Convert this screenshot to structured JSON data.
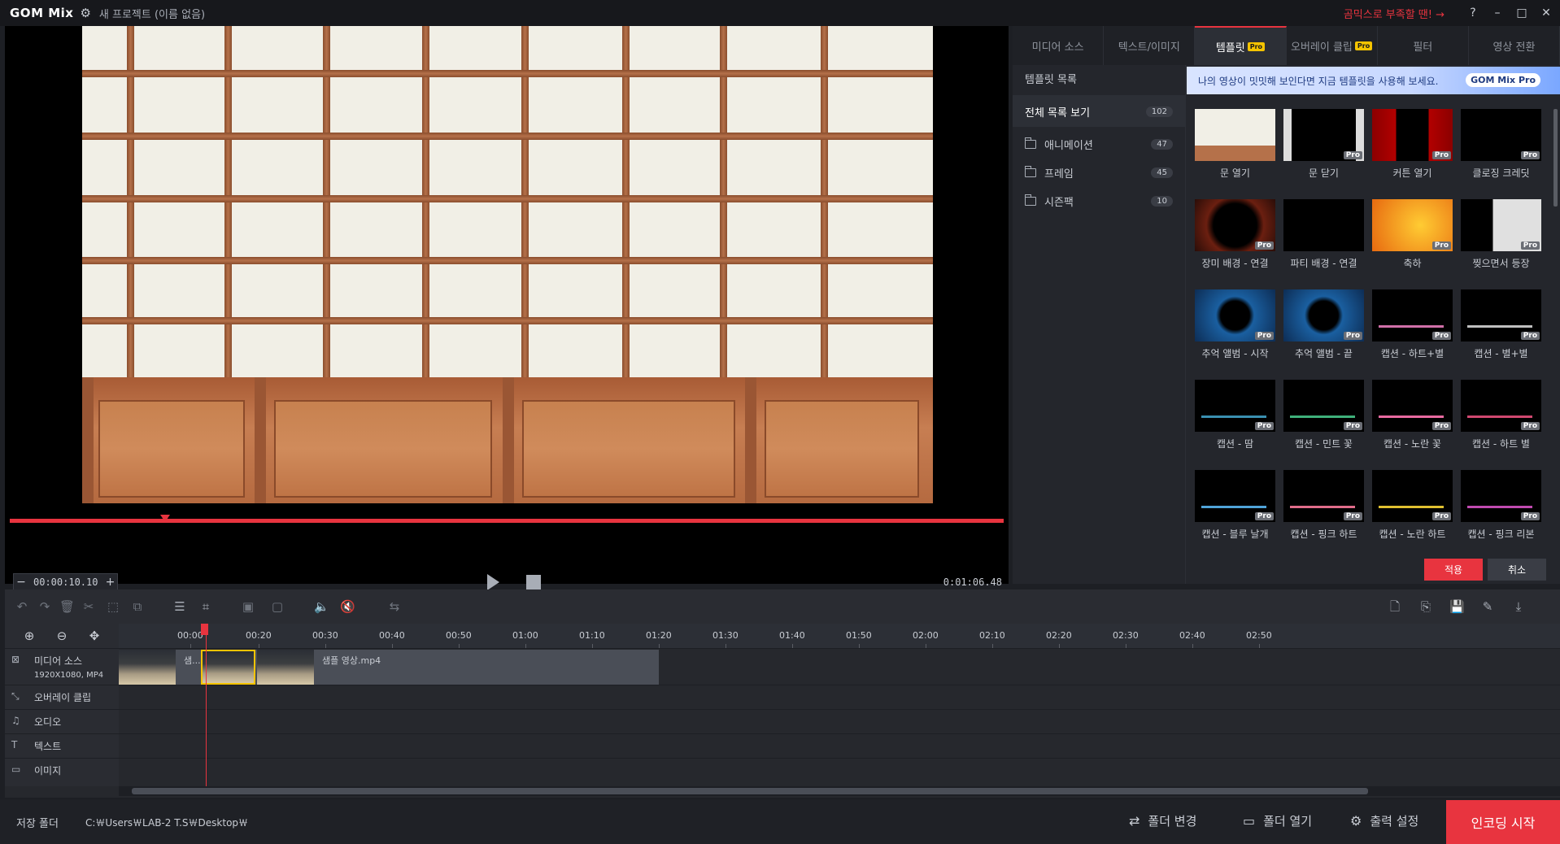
{
  "app": {
    "logo": "GOM Mix",
    "project_title": "새 프로젝트 (이름 없음)",
    "feedback_link": "곰믹스로 부족할 땐! →",
    "help": "?",
    "minimize": "–",
    "maximize": "□",
    "close": "✕"
  },
  "preview": {
    "current_time": "00:00:10.10",
    "total_time": "0:01:06.48",
    "seek_progress": 0.15
  },
  "right_panel": {
    "tabs": [
      {
        "label": "미디어 소스",
        "pro": false,
        "active": false
      },
      {
        "label": "텍스트/이미지",
        "pro": false,
        "active": false
      },
      {
        "label": "템플릿",
        "pro": true,
        "active": true
      },
      {
        "label": "오버레이 클립",
        "pro": true,
        "active": false
      },
      {
        "label": "필터",
        "pro": false,
        "active": false
      },
      {
        "label": "영상 전환",
        "pro": false,
        "active": false
      }
    ],
    "pro_badge": "Pro",
    "category_title": "템플릿 목록",
    "all_list": {
      "label": "전체 목록 보기",
      "count": "102"
    },
    "categories": [
      {
        "label": "애니메이션",
        "count": "47"
      },
      {
        "label": "프레임",
        "count": "45"
      },
      {
        "label": "시즌팩",
        "count": "10"
      }
    ],
    "banner_text": "나의 영상이 밋밋해 보인다면 지금 템플릿을 사용해 보세요.",
    "banner_logo": "GOM Mix Pro",
    "templates": [
      {
        "label": "문 열기",
        "pro": false
      },
      {
        "label": "문 닫기",
        "pro": true
      },
      {
        "label": "커튼 열기",
        "pro": true
      },
      {
        "label": "클로징 크레딧",
        "pro": true
      },
      {
        "label": "장미 배경 - 연결",
        "pro": true
      },
      {
        "label": "파티 배경 - 연결",
        "pro": false
      },
      {
        "label": "축하",
        "pro": true
      },
      {
        "label": "찢으면서 등장",
        "pro": true
      },
      {
        "label": "추억 앨범 - 시작",
        "pro": true
      },
      {
        "label": "추억 앨범 - 끝",
        "pro": true
      },
      {
        "label": "캡션 - 하트+별",
        "pro": true
      },
      {
        "label": "캡션 - 별+별",
        "pro": true
      },
      {
        "label": "캡션 - 땀",
        "pro": true
      },
      {
        "label": "캡션 - 민트 꽃",
        "pro": true
      },
      {
        "label": "캡션 - 노란 꽃",
        "pro": true
      },
      {
        "label": "캡션 - 하트 별",
        "pro": true
      },
      {
        "label": "캡션 - 블루 날개",
        "pro": true
      },
      {
        "label": "캡션 - 핑크 하트",
        "pro": true
      },
      {
        "label": "캡션 - 노란 하트",
        "pro": true
      },
      {
        "label": "캡션 - 핑크 리본",
        "pro": true
      }
    ],
    "apply": "적용",
    "cancel": "취소"
  },
  "timeline": {
    "ticks": [
      "00:00",
      "00:20",
      "00:30",
      "00:40",
      "00:50",
      "01:00",
      "01:10",
      "01:20",
      "01:30",
      "01:40",
      "01:50",
      "02:00",
      "02:10",
      "02:20",
      "02:30",
      "02:40",
      "02:50"
    ],
    "tracks": [
      {
        "label": "미디어 소스",
        "sub": "1920X1080, MP4",
        "icon": "film-icon"
      },
      {
        "label": "오버레이 클립",
        "sub": "",
        "icon": "overlay-icon"
      },
      {
        "label": "오디오",
        "sub": "",
        "icon": "music-icon"
      },
      {
        "label": "텍스트",
        "sub": "",
        "icon": "text-icon"
      },
      {
        "label": "이미지",
        "sub": "",
        "icon": "image-icon"
      }
    ],
    "clip_name": "샘플 영상.mp4",
    "clip_name_short": "샘..."
  },
  "bottom": {
    "save_folder_label": "저장 폴더",
    "save_path": "C:￦Users￦LAB-2 T.S￦Desktop￦",
    "change_folder": "폴더 변경",
    "open_folder": "폴더 열기",
    "output_settings": "출력 설정",
    "encode": "인코딩 시작"
  },
  "colors": {
    "accent": "#e8343f",
    "pro_badge": "#f5c400",
    "background": "#1d1f24"
  }
}
